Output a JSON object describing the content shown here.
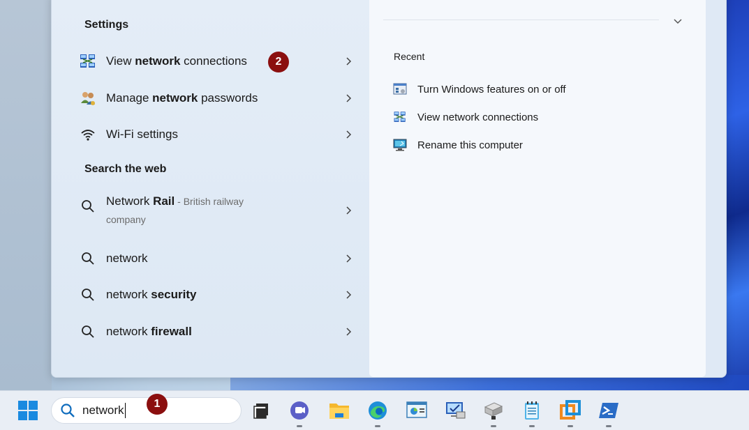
{
  "settings": {
    "title": "Settings",
    "items": [
      {
        "pre": "View ",
        "bold": "network",
        "post": " connections",
        "icon": "network-connections-icon"
      },
      {
        "pre": "Manage ",
        "bold": "network",
        "post": " passwords",
        "icon": "users-key-icon"
      },
      {
        "pre": "Wi-Fi settings",
        "bold": "",
        "post": "",
        "icon": "wifi-icon"
      }
    ]
  },
  "web": {
    "title": "Search the web",
    "items": [
      {
        "pre": "Network ",
        "bold": "Rail",
        "post": "",
        "sub": " - British railway",
        "sub2": "company"
      },
      {
        "pre": "network",
        "bold": "",
        "post": ""
      },
      {
        "pre": "network ",
        "bold": "security",
        "post": ""
      },
      {
        "pre": "network ",
        "bold": "firewall",
        "post": ""
      }
    ]
  },
  "recent": {
    "title": "Recent",
    "items": [
      {
        "label": "Turn Windows features on or off",
        "icon": "windows-features-icon"
      },
      {
        "label": "View network connections",
        "icon": "network-connections-icon"
      },
      {
        "label": "Rename this computer",
        "icon": "computer-icon"
      }
    ]
  },
  "badges": {
    "one": "1",
    "two": "2"
  },
  "taskbar": {
    "search_value": "network",
    "apps": [
      "start-icon",
      "task-view-icon",
      "teams-icon",
      "file-explorer-icon",
      "edge-icon",
      "control-panel-icon",
      "remote-desktop-icon",
      "network-drive-icon",
      "notepad-icon",
      "vmware-icon",
      "powershell-icon"
    ]
  },
  "colors": {
    "badge": "#8b0f0f",
    "accent": "#0067c0"
  }
}
